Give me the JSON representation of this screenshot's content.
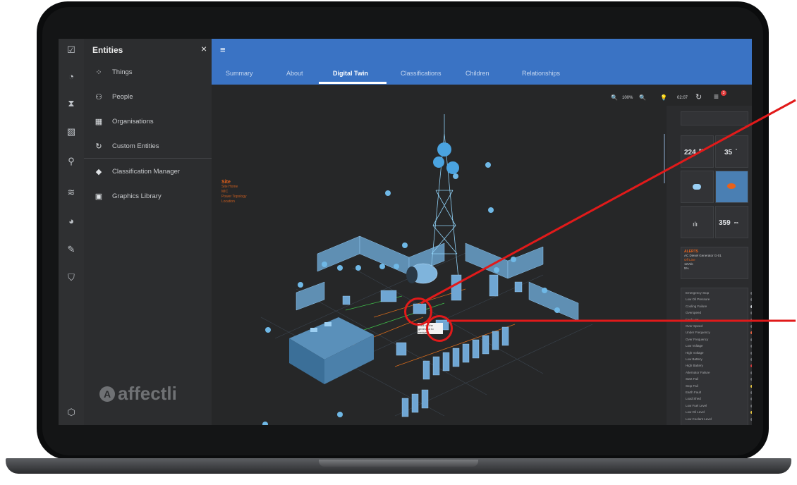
{
  "panel": {
    "title": "Entities",
    "close": "×",
    "items": [
      {
        "label": "Things",
        "icon": "things-icon",
        "glyph": "⁘"
      },
      {
        "label": "People",
        "icon": "people-icon",
        "glyph": "⚇"
      },
      {
        "label": "Organisations",
        "icon": "organisations-icon",
        "glyph": "▦"
      },
      {
        "label": "Custom Entities",
        "icon": "custom-entities-icon",
        "glyph": "↻"
      },
      {
        "label": "Classification Manager",
        "icon": "tag-icon",
        "glyph": "◆"
      },
      {
        "label": "Graphics Library",
        "icon": "image-icon",
        "glyph": "▣"
      }
    ],
    "logo": "affectli"
  },
  "rail": [
    {
      "icon": "checkbox-icon",
      "glyph": "☑"
    },
    {
      "icon": "gauge-icon",
      "glyph": "◔"
    },
    {
      "icon": "hourglass-icon",
      "glyph": "⧗"
    },
    {
      "icon": "map-icon",
      "glyph": "▧"
    },
    {
      "icon": "location-icon",
      "glyph": "⚲"
    },
    {
      "icon": "rss-icon",
      "glyph": "≋"
    },
    {
      "icon": "pie-icon",
      "glyph": "◕"
    },
    {
      "icon": "pencil-icon",
      "glyph": "✎"
    },
    {
      "icon": "shield-icon",
      "glyph": "⛉"
    },
    {
      "icon": "hexagon-icon",
      "glyph": "⬡"
    }
  ],
  "header": {
    "menu": "≡",
    "tabs": [
      "Summary",
      "About",
      "Digital Twin",
      "Classifications",
      "Children",
      "Relationships"
    ],
    "active_tab": "Digital Twin"
  },
  "toolbar": {
    "zoom_out": "🔍",
    "zoom_level": "100%",
    "zoom_in": "🔍",
    "bulb": "💡",
    "timer": "02:07",
    "refresh": "↻",
    "menu": "≡",
    "badge": "3"
  },
  "site": {
    "title": "Site",
    "links": [
      "Site Home",
      "MIC",
      "Power Topology",
      "Location"
    ]
  },
  "callout": {
    "text": "Click on the generator to navigate"
  },
  "widgets": {
    "temp1": "224",
    "temp1_unit": "W",
    "temp2": "35",
    "temp2_unit": "°",
    "signal": "359",
    "signal_unit": "ms"
  },
  "alert": {
    "title": "ALERTS",
    "lines": [
      "AC Diesel Generator G-01",
      "Off Line",
      "12Vdc",
      "5%"
    ]
  },
  "flags": [
    {
      "t": "Emergency Stop",
      "c": "#6a6c70"
    },
    {
      "t": "Low Oil Pressure",
      "c": "#6a6c70"
    },
    {
      "t": "Cooling Failure",
      "c": "#c8cbd0"
    },
    {
      "t": "Overspeed",
      "c": "#6a6c70"
    },
    {
      "t": "Fuel Low",
      "c": "#6a6c70"
    },
    {
      "t": "Over Speed",
      "c": "#6a6c70"
    },
    {
      "t": "Under Frequency",
      "c": "#e06040"
    },
    {
      "t": "Over Frequency",
      "c": "#6a6c70"
    },
    {
      "t": "Low Voltage",
      "c": "#6a6c70"
    },
    {
      "t": "High Voltage",
      "c": "#6a6c70"
    },
    {
      "t": "Low Battery",
      "c": "#6a6c70"
    },
    {
      "t": "High Battery",
      "c": "#d03a3a"
    },
    {
      "t": "Alternator Failure",
      "c": "#6a6c70"
    },
    {
      "t": "Start Fail",
      "c": "#6a6c70"
    },
    {
      "t": "Stop Fail",
      "c": "#e0c040"
    },
    {
      "t": "Earth Fault",
      "c": "#6a6c70"
    },
    {
      "t": "Load Shed",
      "c": "#6a6c70"
    },
    {
      "t": "Low Fuel Level",
      "c": "#6a6c70"
    },
    {
      "t": "Low Oil Level",
      "c": "#e0c040"
    },
    {
      "t": "Low Coolant Level",
      "c": "#6a6c70"
    }
  ]
}
